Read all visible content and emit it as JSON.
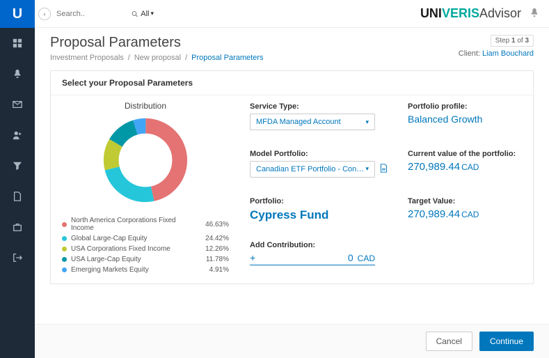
{
  "sidebar": {
    "logo_letter": "U"
  },
  "search": {
    "placeholder": "Search..",
    "filter": "All"
  },
  "brand": {
    "part1": "UNI",
    "part2": "VERIS",
    "part3": " Advisor"
  },
  "step": {
    "label": "Step",
    "current": "1",
    "of": "of",
    "total": "3"
  },
  "client": {
    "label": "Client:",
    "name": "Liam Bouchard"
  },
  "page": {
    "title": "Proposal Parameters",
    "breadcrumb": [
      "Investment Proposals",
      "New proposal",
      "Proposal Parameters"
    ]
  },
  "panel": {
    "heading": "Select your Proposal Parameters"
  },
  "distribution": {
    "title": "Distribution",
    "items": [
      {
        "label": "North America Corporations Fixed Income",
        "value": "46.63%",
        "color": "#e57373"
      },
      {
        "label": "Global Large-Cap Equity",
        "value": "24.42%",
        "color": "#26c6da"
      },
      {
        "label": "USA Corporations Fixed Income",
        "value": "12.26%",
        "color": "#c0ca33"
      },
      {
        "label": "USA Large-Cap Equity",
        "value": "11.78%",
        "color": "#0097a7"
      },
      {
        "label": "Emerging Markets Equity",
        "value": "4.91%",
        "color": "#42a5f5"
      }
    ]
  },
  "fields": {
    "service_type": {
      "label": "Service Type:",
      "value": "MFDA Managed Account"
    },
    "model_portfolio": {
      "label": "Model Portfolio:",
      "value": "Canadian ETF Portfolio - Conserva"
    },
    "portfolio": {
      "label": "Portfolio:",
      "value": "Cypress Fund"
    },
    "add_contribution": {
      "label": "Add Contribution:",
      "plus": "+",
      "value": "0",
      "currency": "CAD"
    },
    "portfolio_profile": {
      "label": "Portfolio profile:",
      "value": "Balanced Growth"
    },
    "current_value": {
      "label": "Current value of the portfolio:",
      "value": "270,989.44",
      "currency": "CAD"
    },
    "target_value": {
      "label": "Target Value:",
      "value": "270,989.44",
      "currency": "CAD"
    }
  },
  "footer": {
    "cancel": "Cancel",
    "continue": "Continue"
  },
  "chart_data": {
    "type": "pie",
    "title": "Distribution",
    "hole": 0.6,
    "series": [
      {
        "name": "North America Corporations Fixed Income",
        "value": 46.63,
        "color": "#e57373"
      },
      {
        "name": "Global Large-Cap Equity",
        "value": 24.42,
        "color": "#26c6da"
      },
      {
        "name": "USA Corporations Fixed Income",
        "value": 12.26,
        "color": "#c0ca33"
      },
      {
        "name": "USA Large-Cap Equity",
        "value": 11.78,
        "color": "#0097a7"
      },
      {
        "name": "Emerging Markets Equity",
        "value": 4.91,
        "color": "#42a5f5"
      }
    ]
  }
}
